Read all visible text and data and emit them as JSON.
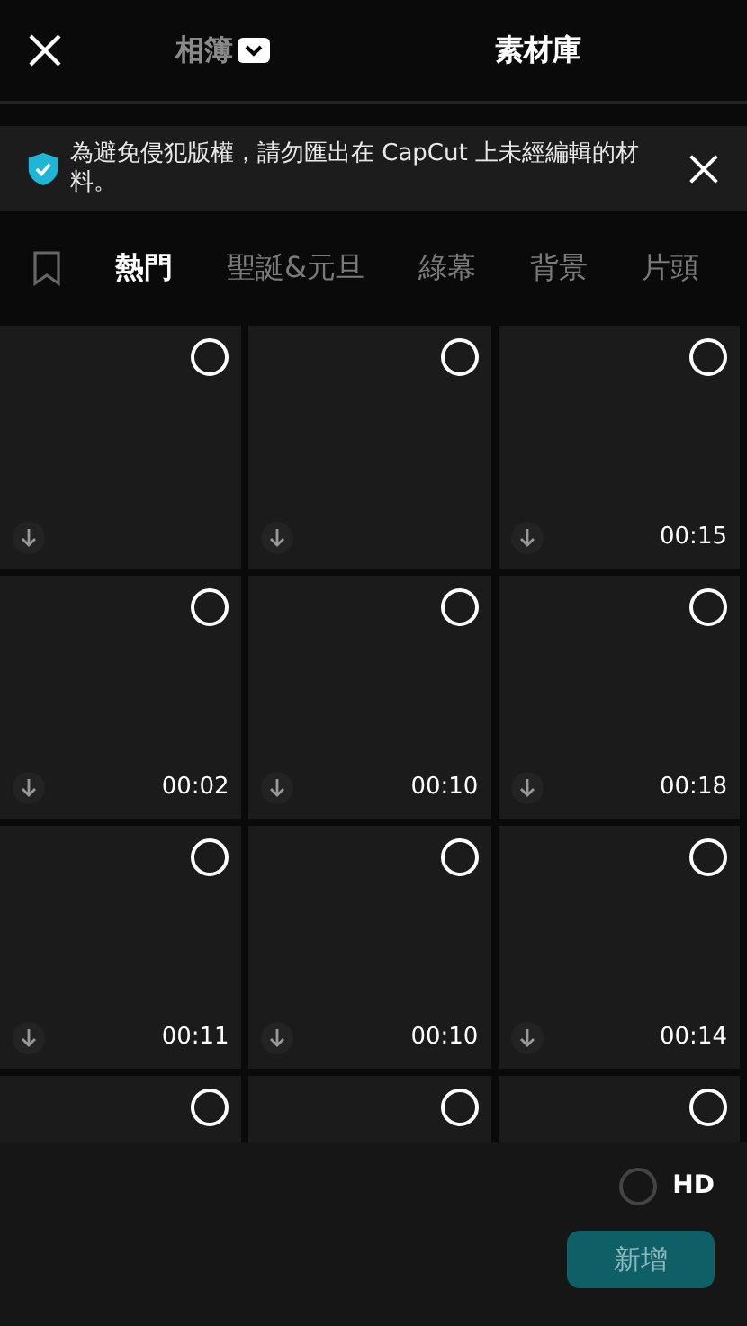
{
  "header": {
    "tabs": [
      {
        "label": "相簿",
        "selected": false,
        "dropdown": true
      },
      {
        "label": "素材庫",
        "selected": true,
        "dropdown": false
      }
    ]
  },
  "notice": {
    "text": "為避免侵犯版權，請勿匯出在 CapCut 上未經編輯的材料。"
  },
  "categories": [
    {
      "label": "熱門",
      "selected": true
    },
    {
      "label": "聖誕&元旦",
      "selected": false
    },
    {
      "label": "綠幕",
      "selected": false
    },
    {
      "label": "背景",
      "selected": false
    },
    {
      "label": "片頭",
      "selected": false
    }
  ],
  "tiles": [
    {
      "kind": "full",
      "selected": false
    },
    {
      "kind": "full",
      "selected": false
    },
    {
      "kind": "full",
      "selected": false,
      "duration": "00:15"
    },
    {
      "kind": "full",
      "selected": false,
      "duration": "00:02"
    },
    {
      "kind": "full",
      "selected": false,
      "duration": "00:10"
    },
    {
      "kind": "full",
      "selected": false,
      "duration": "00:18"
    },
    {
      "kind": "full",
      "selected": false,
      "duration": "00:11"
    },
    {
      "kind": "full",
      "selected": false,
      "duration": "00:10"
    },
    {
      "kind": "full",
      "selected": false,
      "duration": "00:14"
    },
    {
      "kind": "cut",
      "selected": false
    },
    {
      "kind": "cut",
      "selected": false
    },
    {
      "kind": "cut",
      "selected": false
    }
  ],
  "hd": {
    "label": "HD",
    "checked": false
  },
  "add_button": {
    "label": "新增"
  }
}
